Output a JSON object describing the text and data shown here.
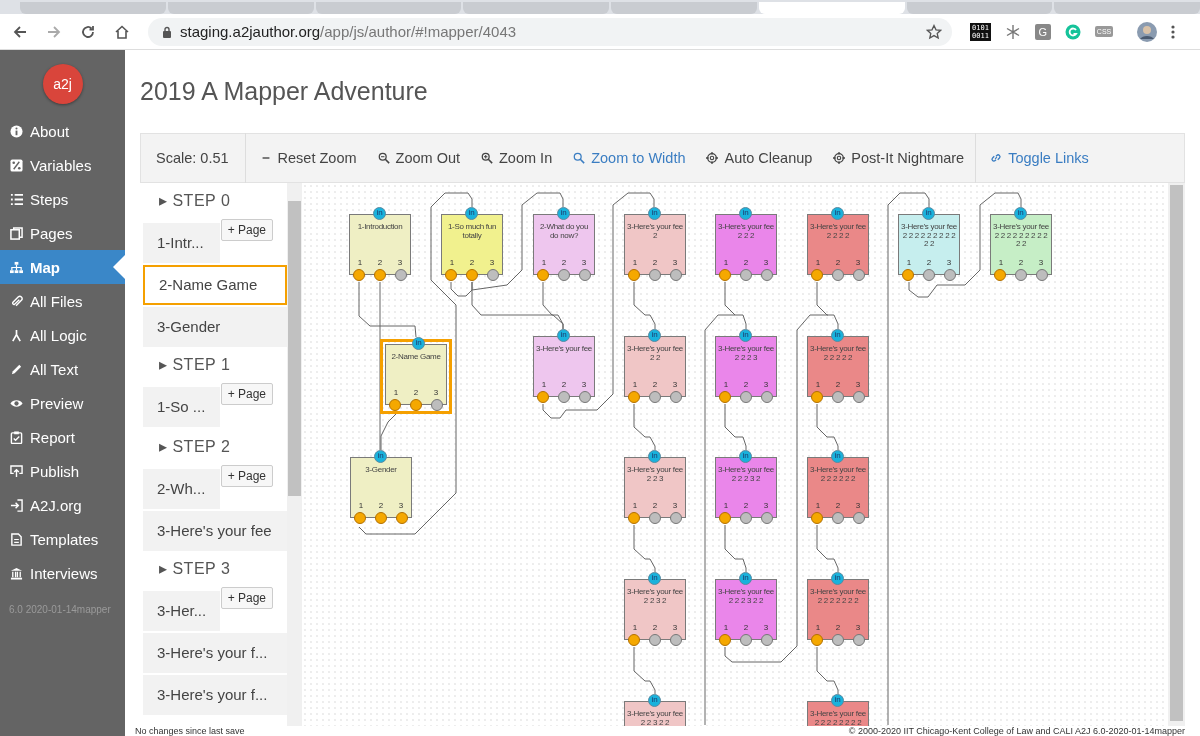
{
  "browser": {
    "tabs": [
      {
        "selected": false
      },
      {
        "selected": false
      },
      {
        "selected": false
      },
      {
        "selected": false
      },
      {
        "selected": false
      },
      {
        "selected": true
      },
      {
        "selected": false
      },
      {
        "selected": false
      }
    ],
    "url_host": "staging.a2jauthor.org",
    "url_path": "/app/js/author/#!mapper/4043",
    "ext_binary": [
      "0101",
      "0011"
    ],
    "ext_letter": "G",
    "ext_css": "CSS"
  },
  "sidebar": {
    "logo": "a2j",
    "items": [
      {
        "label": "About",
        "selected": false
      },
      {
        "label": "Variables",
        "selected": false
      },
      {
        "label": "Steps",
        "selected": false
      },
      {
        "label": "Pages",
        "selected": false
      },
      {
        "label": "Map",
        "selected": true
      },
      {
        "label": "All Files",
        "selected": false
      },
      {
        "label": "All Logic",
        "selected": false
      },
      {
        "label": "All Text",
        "selected": false
      },
      {
        "label": "Preview",
        "selected": false
      },
      {
        "label": "Report",
        "selected": false
      },
      {
        "label": "Publish",
        "selected": false
      },
      {
        "label": "A2J.org",
        "selected": false
      },
      {
        "label": "Templates",
        "selected": false
      },
      {
        "label": "Interviews",
        "selected": false
      }
    ],
    "version": "6.0 2020-01-14mapper"
  },
  "title": "2019 A Mapper Adventure",
  "toolbar": {
    "scale": "Scale: 0.51",
    "buttons": [
      {
        "label": "Reset Zoom",
        "active": false
      },
      {
        "label": "Zoom Out",
        "active": false
      },
      {
        "label": "Zoom In",
        "active": false
      },
      {
        "label": "Zoom to Width",
        "active": true
      },
      {
        "label": "Auto Cleanup",
        "active": false
      },
      {
        "label": "Post-It Nightmare",
        "active": false
      }
    ],
    "toggle_links": "Toggle Links"
  },
  "steps": [
    {
      "marker": "▸",
      "label": "STEP 0",
      "add": "+ Page",
      "pages": [
        {
          "label": "1-Intr...",
          "selected": false
        },
        {
          "label": "2-Name Game",
          "selected": true
        },
        {
          "label": "3-Gender",
          "selected": false
        }
      ]
    },
    {
      "marker": "▸",
      "label": "STEP 1",
      "add": "+ Page",
      "pages": [
        {
          "label": "1-So ...",
          "selected": false
        }
      ]
    },
    {
      "marker": "▸",
      "label": "STEP 2",
      "add": "+ Page",
      "pages": [
        {
          "label": "2-Wh...",
          "selected": false
        },
        {
          "label": "3-Here's your fee",
          "selected": false
        }
      ]
    },
    {
      "marker": "▸",
      "label": "STEP 3",
      "add": "+ Page",
      "pages": [
        {
          "label": "3-Her...",
          "selected": false
        },
        {
          "label": "3-Here's your f...",
          "selected": false
        },
        {
          "label": "3-Here's your f...",
          "selected": false
        }
      ]
    }
  ],
  "map": {
    "nodes": [
      {
        "title": "1-Introduction",
        "color": "#efefc4",
        "selected": false,
        "in": "in",
        "ports": [
          {
            "label": "1",
            "linked": true
          },
          {
            "label": "2",
            "linked": true
          },
          {
            "label": "3",
            "linked": false
          }
        ]
      },
      {
        "title": "1-So much fun totally",
        "color": "#f1f18e",
        "selected": false,
        "in": "in",
        "ports": [
          {
            "label": "1",
            "linked": true
          },
          {
            "label": "2",
            "linked": true
          },
          {
            "label": "3",
            "linked": false
          }
        ]
      },
      {
        "title": "2-What do you do now?",
        "color": "#eec6ee",
        "selected": false,
        "in": "in",
        "ports": [
          {
            "label": "1",
            "linked": true
          },
          {
            "label": "2",
            "linked": false
          },
          {
            "label": "3",
            "linked": false
          }
        ]
      },
      {
        "title": "3-Here's your fee 2",
        "color": "#f0c6c6",
        "selected": false,
        "in": "in",
        "ports": [
          {
            "label": "1",
            "linked": true
          },
          {
            "label": "2",
            "linked": false
          },
          {
            "label": "3",
            "linked": false
          }
        ]
      },
      {
        "title": "3-Here's your fee 2 2 2",
        "color": "#ea86ea",
        "selected": false,
        "in": "in",
        "ports": [
          {
            "label": "1",
            "linked": true
          },
          {
            "label": "2",
            "linked": false
          },
          {
            "label": "3",
            "linked": false
          }
        ]
      },
      {
        "title": "3-Here's your fee 2 2 2 2",
        "color": "#ea8888",
        "selected": false,
        "in": "in",
        "ports": [
          {
            "label": "1",
            "linked": true
          },
          {
            "label": "2",
            "linked": false
          },
          {
            "label": "3",
            "linked": false
          }
        ]
      },
      {
        "title": "3-Here's your fee 2 2 2 2 2 2 2 2 2 2 2",
        "color": "#c6eeee",
        "selected": false,
        "in": "in",
        "ports": [
          {
            "label": "1",
            "linked": true
          },
          {
            "label": "2",
            "linked": false
          },
          {
            "label": "3",
            "linked": false
          }
        ]
      },
      {
        "title": "3-Here's your fee 2 2 2 2 2 2 2 2 2 2 2",
        "color": "#c6eec6",
        "selected": false,
        "in": "in",
        "ports": [
          {
            "label": "1",
            "linked": true
          },
          {
            "label": "2",
            "linked": false
          },
          {
            "label": "3",
            "linked": false
          }
        ]
      },
      {
        "title": "2-Name Game",
        "color": "#efefc4",
        "selected": true,
        "in": "in",
        "ports": [
          {
            "label": "1",
            "linked": true
          },
          {
            "label": "2",
            "linked": true
          },
          {
            "label": "3",
            "linked": false
          }
        ]
      },
      {
        "title": "3-Here's your fee",
        "color": "#eec6ee",
        "selected": false,
        "in": "in",
        "ports": [
          {
            "label": "1",
            "linked": true
          },
          {
            "label": "2",
            "linked": false
          },
          {
            "label": "3",
            "linked": false
          }
        ]
      },
      {
        "title": "3-Here's your fee 2 2",
        "color": "#f0c6c6",
        "selected": false,
        "in": "in",
        "ports": [
          {
            "label": "1",
            "linked": true
          },
          {
            "label": "2",
            "linked": false
          },
          {
            "label": "3",
            "linked": false
          }
        ]
      },
      {
        "title": "3-Here's your fee 2 2 2 3",
        "color": "#ea86ea",
        "selected": false,
        "in": "in",
        "ports": [
          {
            "label": "1",
            "linked": true
          },
          {
            "label": "2",
            "linked": false
          },
          {
            "label": "3",
            "linked": false
          }
        ]
      },
      {
        "title": "3-Here's your fee 2 2 2 2 2",
        "color": "#ea8888",
        "selected": false,
        "in": "in",
        "ports": [
          {
            "label": "1",
            "linked": true
          },
          {
            "label": "2",
            "linked": false
          },
          {
            "label": "3",
            "linked": false
          }
        ]
      },
      {
        "title": "3-Gender",
        "color": "#efefc4",
        "selected": false,
        "in": "in",
        "ports": [
          {
            "label": "1",
            "linked": true
          },
          {
            "label": "2",
            "linked": true
          },
          {
            "label": "3",
            "linked": true
          }
        ]
      },
      {
        "title": "3-Here's your fee 2 2 3",
        "color": "#f0c6c6",
        "selected": false,
        "in": "in",
        "ports": [
          {
            "label": "1",
            "linked": true
          },
          {
            "label": "2",
            "linked": false
          },
          {
            "label": "3",
            "linked": false
          }
        ]
      },
      {
        "title": "3-Here's your fee 2 2 2 3 2",
        "color": "#ea86ea",
        "selected": false,
        "in": "in",
        "ports": [
          {
            "label": "1",
            "linked": true
          },
          {
            "label": "2",
            "linked": false
          },
          {
            "label": "3",
            "linked": false
          }
        ]
      },
      {
        "title": "3-Here's your fee 2 2 2 2 2 2",
        "color": "#ea8888",
        "selected": false,
        "in": "in",
        "ports": [
          {
            "label": "1",
            "linked": true
          },
          {
            "label": "2",
            "linked": false
          },
          {
            "label": "3",
            "linked": false
          }
        ]
      },
      {
        "title": "3-Here's your fee 2 2 3 2",
        "color": "#f0c6c6",
        "selected": false,
        "in": "in",
        "ports": [
          {
            "label": "1",
            "linked": true
          },
          {
            "label": "2",
            "linked": false
          },
          {
            "label": "3",
            "linked": false
          }
        ]
      },
      {
        "title": "3-Here's your fee 2 2 2 3 2 2",
        "color": "#ea86ea",
        "selected": false,
        "in": "in",
        "ports": [
          {
            "label": "1",
            "linked": true
          },
          {
            "label": "2",
            "linked": false
          },
          {
            "label": "3",
            "linked": false
          }
        ]
      },
      {
        "title": "3-Here's your fee 2 2 2 2 2 2 2",
        "color": "#ea8888",
        "selected": false,
        "in": "in",
        "ports": [
          {
            "label": "1",
            "linked": true
          },
          {
            "label": "2",
            "linked": false
          },
          {
            "label": "3",
            "linked": false
          }
        ]
      },
      {
        "title": "3-Here's your fee 2 2 3 2 2",
        "color": "#f0c6c6",
        "selected": false,
        "in": "in"
      },
      {
        "title": "3-Here's your fee 2 2 2 2 2 2 2 2",
        "color": "#ea8888",
        "selected": false,
        "in": "in"
      }
    ]
  },
  "status": {
    "left": "No changes since last save",
    "right": "© 2000-2020 IIT Chicago-Kent College of Law and CALI A2J 6.0-2020-01-14mapper"
  }
}
